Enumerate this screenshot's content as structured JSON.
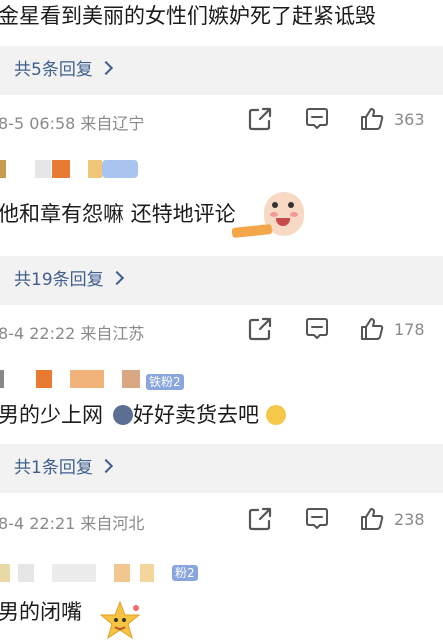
{
  "comments": [
    {
      "text": "金星看到美丽的女性们嫉妒死了赶紧诋毁",
      "replies": "共5条回复",
      "meta": "8-5 06:58 来自辽宁",
      "likes": "363"
    },
    {
      "text": "他和章有怨嘛  还特地评论",
      "replies": "共19条回复",
      "meta": "8-4 22:22 来自江苏",
      "likes": "178"
    },
    {
      "text_a": "男的少上网",
      "text_b": "好好卖货去吧",
      "badge": "铁粉2",
      "replies": "共1条回复",
      "meta": "8-4 22:21 来自河北",
      "likes": "238"
    },
    {
      "text": "男的闭嘴",
      "badge": "粉2"
    }
  ],
  "colors": {
    "link": "#3f5f8f",
    "meta": "#8a8a8a",
    "reply_bg": "#f2f2f2"
  },
  "icons": [
    "share-icon",
    "comment-icon",
    "thumbs-up-icon",
    "chevron-right-icon"
  ]
}
